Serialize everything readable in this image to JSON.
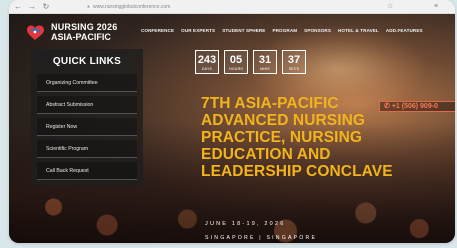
{
  "browser": {
    "url": "www.nursingglobalconference.com",
    "back_icon": "arrow-left-icon",
    "reload_icon": "reload-icon",
    "star_icon": "star-icon",
    "menu_icon": "menu-icon"
  },
  "header": {
    "logo_line1": "NURSING 2026",
    "logo_line2": "ASIA-PACIFIC",
    "nav": [
      "CONFERENCE",
      "OUR EXPERTS",
      "STUDENT SPHERE",
      "PROGRAM",
      "SPONSORS",
      "HOTEL & TRAVEL",
      "ADD.FEATURES"
    ]
  },
  "quick_links": {
    "title": "QUICK LINKS",
    "items": [
      "Organizing Committee",
      "Abstract Submission",
      "Register Now",
      "Scientific Program",
      "Call Back Request"
    ]
  },
  "countdown": [
    {
      "value": "243",
      "label": "DAYS"
    },
    {
      "value": "05",
      "label": "HOURS"
    },
    {
      "value": "31",
      "label": "MINS"
    },
    {
      "value": "37",
      "label": "SECS"
    }
  ],
  "phone": "+1 (506) 909-0",
  "hero": {
    "line1": "7TH ASIA-PACIFIC",
    "line2": "ADVANCED NURSING",
    "line3": "PRACTICE, NURSING",
    "line4": "EDUCATION AND",
    "line5": "LEADERSHIP CONCLAVE"
  },
  "event": {
    "date": "JUNE 18-19, 2026",
    "location": "SINGAPORE | SINGAPORE"
  },
  "colors": {
    "accent": "#f2b41c",
    "phone": "#ff7a55",
    "logo_red": "#e4373b",
    "logo_blue": "#2a6fc9"
  }
}
